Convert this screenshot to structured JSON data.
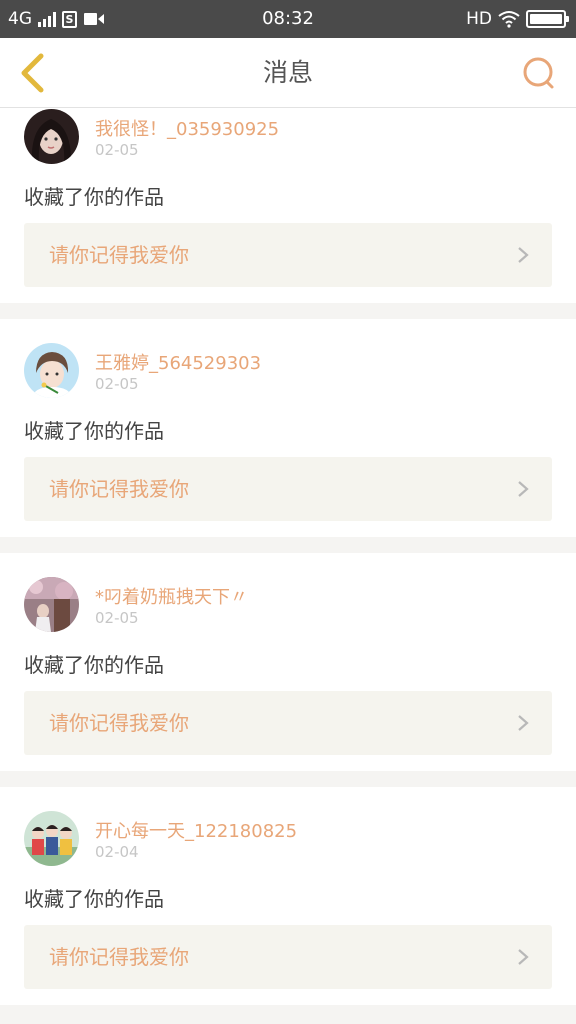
{
  "status_bar": {
    "network": "4G",
    "time": "08:32",
    "hd": "HD"
  },
  "header": {
    "title": "消息",
    "back_icon": "chevron-left-icon",
    "search_icon": "search-icon"
  },
  "colors": {
    "accent": "#e8a678",
    "back_icon": "#e2b83c",
    "status_bar": "#4a4a4a",
    "card_link_bg": "#f5f4ee",
    "page_bg": "#f5f4f2"
  },
  "messages": [
    {
      "username": "我很怪！_035930925",
      "date": "02-05",
      "action": "收藏了你的作品",
      "work_title": "请你记得我爱你"
    },
    {
      "username": "王雅婷_564529303",
      "date": "02-05",
      "action": "收藏了你的作品",
      "work_title": "请你记得我爱你"
    },
    {
      "username": "*叼着奶瓶拽天下〃",
      "date": "02-05",
      "action": "收藏了你的作品",
      "work_title": "请你记得我爱你"
    },
    {
      "username": "开心每一天_122180825",
      "date": "02-04",
      "action": "收藏了你的作品",
      "work_title": "请你记得我爱你"
    }
  ]
}
